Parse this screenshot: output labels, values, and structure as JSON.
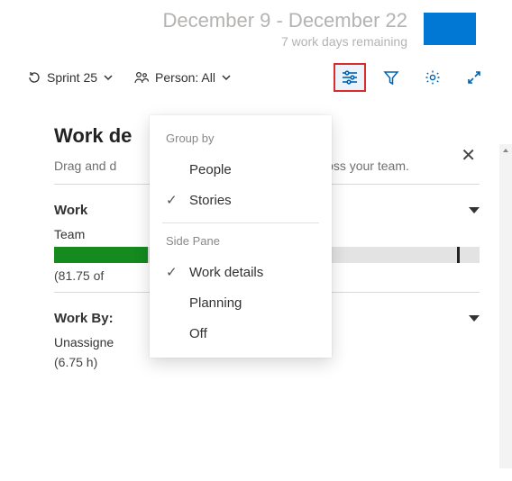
{
  "header": {
    "date_range": "December 9 - December 22",
    "subtitle": "7 work days remaining"
  },
  "toolbar": {
    "sprint_label": "Sprint 25",
    "person_label": "Person: All"
  },
  "panel": {
    "title_full": "Work details",
    "title_visible": "Work de",
    "instruction_full": "Drag and drop work items to balance work across your team.",
    "instruction_left": "Drag and d",
    "instruction_right": "rk across your team.",
    "close_glyph": "✕"
  },
  "sections": {
    "work": {
      "head": "Work",
      "sub": "Team",
      "note": "(81.75 of",
      "bar_percent": 22
    },
    "workby": {
      "head_full": "Work By: Assigned To",
      "head_visible": "Work By:",
      "sub_full": "Unassigned",
      "sub_visible": "Unassigne",
      "note": "(6.75 h)"
    }
  },
  "menu": {
    "group_by_label": "Group by",
    "side_pane_label": "Side Pane",
    "items_group": [
      {
        "label": "People",
        "checked": false
      },
      {
        "label": "Stories",
        "checked": true
      }
    ],
    "items_pane": [
      {
        "label": "Work details",
        "checked": true
      },
      {
        "label": "Planning",
        "checked": false
      },
      {
        "label": "Off",
        "checked": false
      }
    ]
  },
  "colors": {
    "accent": "#0078d4",
    "highlight_border": "#d92c2c",
    "bar_fill": "#148a1f"
  }
}
